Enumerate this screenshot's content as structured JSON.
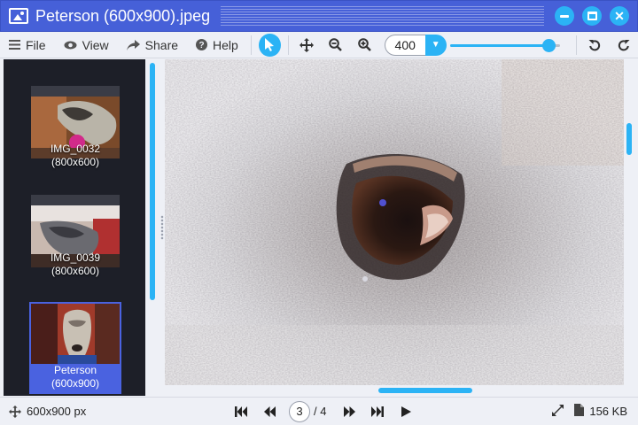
{
  "window": {
    "title": "Peterson (600x900).jpeg"
  },
  "toolbar": {
    "file_label": "File",
    "view_label": "View",
    "share_label": "Share",
    "help_label": "Help",
    "zoom_value": "400",
    "zoom_slider_fraction": 0.9
  },
  "sidebar": {
    "items": [
      {
        "name": "IMG_0032",
        "size": "(800x600)",
        "selected": false
      },
      {
        "name": "IMG_0039",
        "size": "(800x600)",
        "selected": false
      },
      {
        "name": "Peterson",
        "size": "(600x900)",
        "selected": true
      }
    ]
  },
  "status": {
    "dimensions": "600x900 px",
    "current_page": "3",
    "total_pages": "/ 4",
    "file_size": "156 KB"
  },
  "colors": {
    "titlebar": "#4660d8",
    "accent": "#2bb3f5",
    "sidebar_bg": "#1d1f28",
    "selection": "#4a62e0"
  },
  "icons": {
    "app": "image-icon",
    "pointer": "cursor-arrow-icon",
    "move": "move-arrows-icon",
    "zoom_out": "zoom-out-icon",
    "zoom_in": "zoom-in-icon",
    "rotate_left": "rotate-left-icon",
    "rotate_right": "rotate-right-icon"
  }
}
